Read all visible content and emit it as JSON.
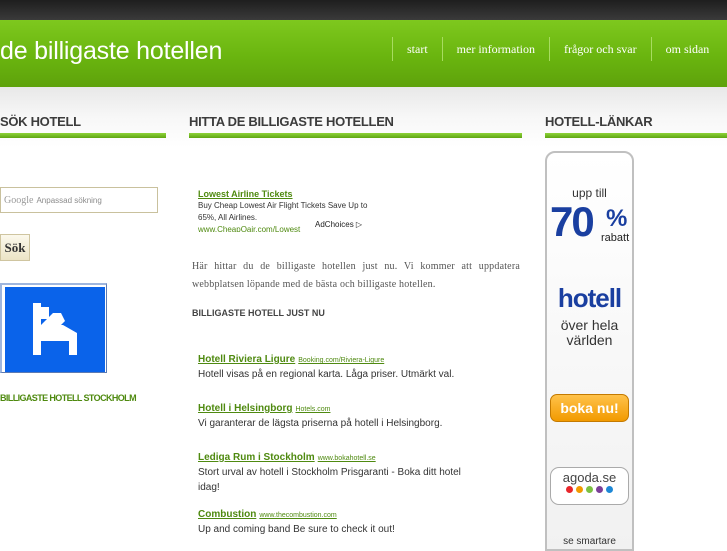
{
  "header": {
    "site_title": "de billigaste hotellen",
    "nav": [
      "start",
      "mer information",
      "frågor och svar",
      "om sidan"
    ]
  },
  "left": {
    "heading": "SÖK HOTELL",
    "search_brand": "Google",
    "search_placeholder": "Anpassad sökning",
    "search_button": "Sök",
    "sign_caption": "BILLIGASTE HOTELL STOCKHOLM"
  },
  "main": {
    "heading": "HITTA DE BILLIGASTE HOTELLEN",
    "ad": {
      "title": "Lowest Airline Tickets",
      "desc": "Buy Cheap Lowest Air Flight Tickets Save Up to 65%, All Airlines.",
      "url": "www.CheapOair.com/Lowest",
      "adchoices": "AdChoices ▷"
    },
    "intro": "Här hittar du de billigaste hotellen just nu. Vi kommer att uppdatera webbplatsen löpande med de bästa och billigaste hotellen.",
    "subheading": "BILLIGASTE HOTELL JUST NU",
    "listings": [
      {
        "title": "Hotell Riviera Ligure",
        "url": "Booking.com/Riviera-Ligure",
        "desc": "Hotell visas på en regional karta. Låga priser. Utmärkt val."
      },
      {
        "title": "Hotell i Helsingborg",
        "url": "Hotels.com",
        "desc": "Vi garanterar de lägsta priserna på hotell i Helsingborg."
      },
      {
        "title": "Lediga Rum i Stockholm",
        "url": "www.bokahotell.se",
        "desc": "Stort urval av hotell i Stockholm Prisgaranti - Boka ditt hotel idag!"
      },
      {
        "title": "Combustion",
        "url": "www.thecombustion.com",
        "desc": "Up and coming band Be sure to check it out!"
      }
    ]
  },
  "right": {
    "heading": "HOTELL-LÄNKAR",
    "banner": {
      "upp": "upp till",
      "pct": "70",
      "pct_sign": "%",
      "rabatt": "rabatt",
      "hotell": "hotell",
      "over": "över hela världen",
      "button": "boka nu!",
      "brand": "agoda.se",
      "more": "se smartare"
    }
  },
  "colors": {
    "accent_green": "#6ab50f",
    "link_green": "#4f8a10",
    "sign_blue": "#0a63ea",
    "banner_blue": "#1a3fa0",
    "cta_orange": "#f29a00"
  }
}
